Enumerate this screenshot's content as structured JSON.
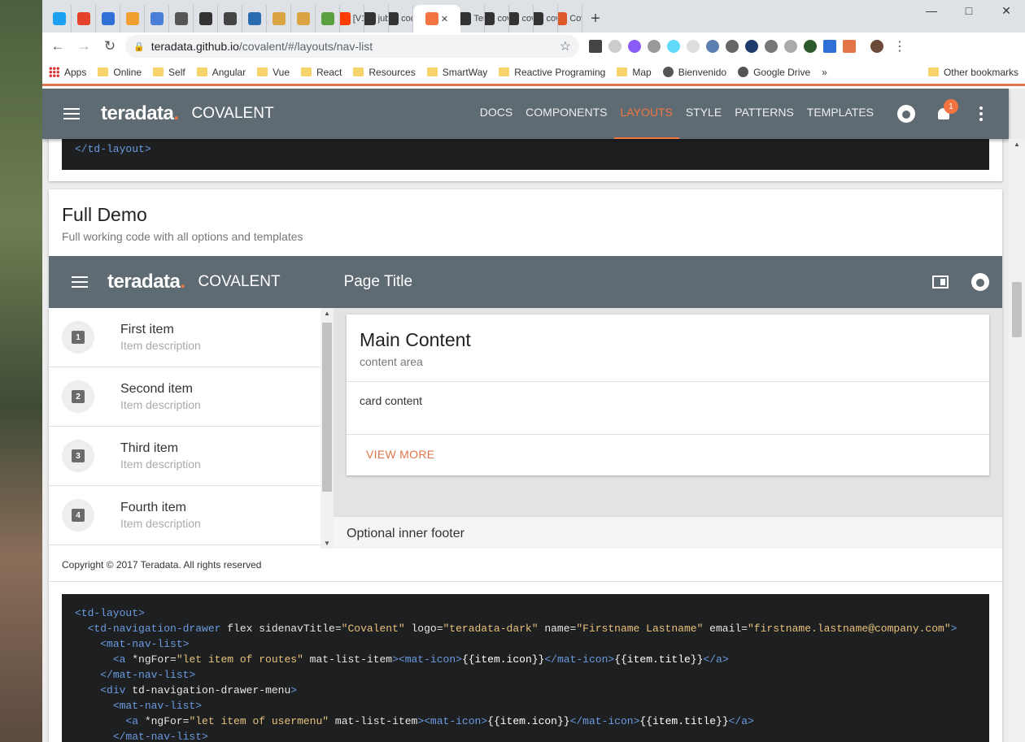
{
  "browser": {
    "tabs": [
      {
        "label": "",
        "color": "#1da1f2"
      },
      {
        "label": "",
        "color": "#e24329"
      },
      {
        "label": "",
        "color": "#2f6fd6"
      },
      {
        "label": "",
        "color": "#f0a030"
      },
      {
        "label": "",
        "color": "#4a7fd8"
      },
      {
        "label": "",
        "color": "#555555"
      },
      {
        "label": "",
        "color": "#333333"
      },
      {
        "label": "",
        "color": "#444444"
      },
      {
        "label": "",
        "color": "#2b6cb0"
      },
      {
        "label": "",
        "color": "#d9a441"
      },
      {
        "label": "",
        "color": "#d9a441"
      },
      {
        "label": "",
        "color": "#5aa041"
      },
      {
        "label": "[V1",
        "color": "#ff3d00"
      },
      {
        "label": "jub",
        "color": "#333333"
      },
      {
        "label": "cod",
        "color": "#333333"
      },
      {
        "label": "",
        "color": "#f37440",
        "active": true
      },
      {
        "label": "Ter",
        "color": "#333333"
      },
      {
        "label": "cov",
        "color": "#333333"
      },
      {
        "label": "cov",
        "color": "#333333"
      },
      {
        "label": "cov",
        "color": "#333333"
      },
      {
        "label": "Cov",
        "color": "#dd5a2b"
      }
    ],
    "url_host": "teradata.github.io",
    "url_path": "/covalent/#/layouts/nav-list",
    "bookmarks": [
      "Apps",
      "Online",
      "Self",
      "Angular",
      "Vue",
      "React",
      "Resources",
      "SmartWay",
      "Reactive Programing",
      "Map",
      "Bienvenido",
      "Google Drive",
      "»",
      "Other bookmarks"
    ]
  },
  "appbar": {
    "logo": "teradata",
    "logo_dot": ".",
    "brand": "COVALENT",
    "nav": [
      "DOCS",
      "COMPONENTS",
      "LAYOUTS",
      "STYLE",
      "PATTERNS",
      "TEMPLATES"
    ],
    "active_nav": "LAYOUTS",
    "notification_count": "1",
    "accent": "#f37440",
    "bar_color": "#5f6b72"
  },
  "prev_code": "</td-layout>",
  "full_demo": {
    "title": "Full Demo",
    "subtitle": "Full working code with all options and templates",
    "demo_bar": {
      "logo": "teradata",
      "logo_dot": ".",
      "brand": "COVALENT",
      "page_title": "Page Title"
    },
    "nav_items": [
      {
        "icon": "1",
        "title": "First item",
        "desc": "Item description"
      },
      {
        "icon": "2",
        "title": "Second item",
        "desc": "Item description"
      },
      {
        "icon": "3",
        "title": "Third item",
        "desc": "Item description"
      },
      {
        "icon": "4",
        "title": "Fourth item",
        "desc": "Item description"
      }
    ],
    "main_card": {
      "title": "Main Content",
      "subtitle": "content area",
      "body": "card content",
      "action": "VIEW MORE"
    },
    "inner_footer": "Optional inner footer",
    "copyright": "Copyright © 2017 Teradata. All rights reserved"
  },
  "code_lines": [
    "<td-layout>",
    "  <td-navigation-drawer flex sidenavTitle=\"Covalent\" logo=\"teradata-dark\" name=\"Firstname Lastname\" email=\"firstname.lastname@company.com\">",
    "    <mat-nav-list>",
    "      <a *ngFor=\"let item of routes\" mat-list-item><mat-icon>{{item.icon}}</mat-icon>{{item.title}}</a>",
    "    </mat-nav-list>",
    "    <div td-navigation-drawer-menu>",
    "      <mat-nav-list>",
    "        <a *ngFor=\"let item of usermenu\" mat-list-item><mat-icon>{{item.icon}}</mat-icon>{{item.title}}</a>",
    "      </mat-nav-list>"
  ]
}
